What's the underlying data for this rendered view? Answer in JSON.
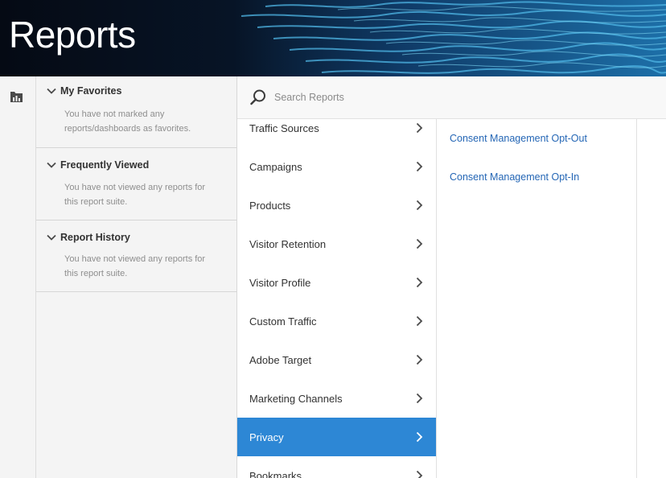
{
  "header": {
    "title": "Reports"
  },
  "rail": {
    "icon": "folder-report-icon"
  },
  "favorites": [
    {
      "title": "My Favorites",
      "message": "You have not marked any reports/dashboards as favorites."
    },
    {
      "title": "Frequently Viewed",
      "message": "You have not viewed any reports for this report suite."
    },
    {
      "title": "Report History",
      "message": "You have not viewed any reports for this report suite."
    }
  ],
  "search": {
    "placeholder": "Search Reports",
    "icon": "search-icon"
  },
  "menu": {
    "items": [
      {
        "label": "Traffic Sources"
      },
      {
        "label": "Campaigns"
      },
      {
        "label": "Products"
      },
      {
        "label": "Visitor Retention"
      },
      {
        "label": "Visitor Profile"
      },
      {
        "label": "Custom Traffic"
      },
      {
        "label": "Adobe Target"
      },
      {
        "label": "Marketing Channels"
      },
      {
        "label": "Privacy"
      },
      {
        "label": "Bookmarks"
      }
    ],
    "selected": "Privacy"
  },
  "submenu": {
    "items": [
      {
        "label": "Consent Management Opt-Out"
      },
      {
        "label": "Consent Management Opt-In"
      }
    ]
  },
  "colors": {
    "accent": "#2d87d5",
    "link": "#2466b5",
    "banner": "#050a14"
  }
}
